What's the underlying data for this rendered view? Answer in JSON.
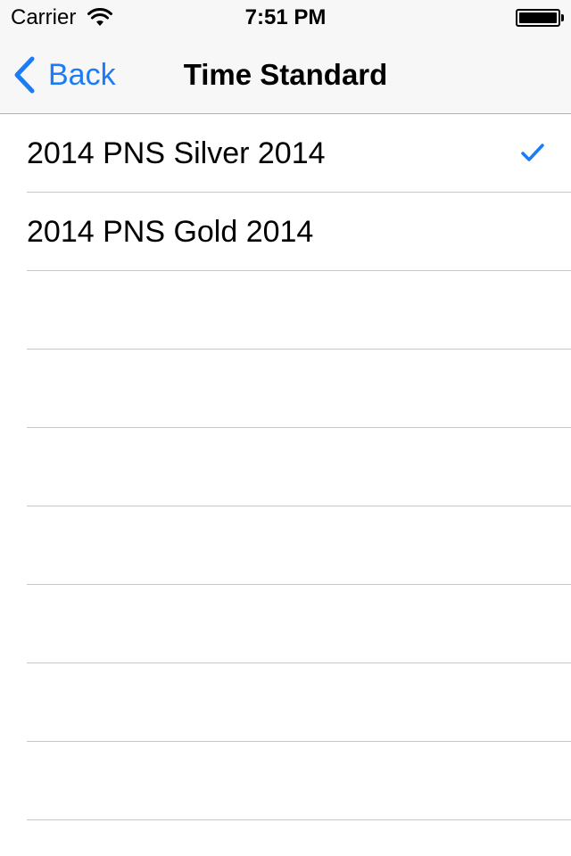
{
  "status_bar": {
    "carrier": "Carrier",
    "time": "7:51 PM",
    "wifi_icon": "wifi-icon",
    "battery_icon": "battery-full-icon"
  },
  "nav_bar": {
    "back_label": "Back",
    "title": "Time Standard",
    "back_icon": "chevron-left-icon"
  },
  "colors": {
    "accent": "#1b7cf5",
    "chrome_bg": "#f7f7f7",
    "separator": "#c8c7cc"
  },
  "list": {
    "items": [
      {
        "label": "2014 PNS Silver 2014",
        "selected": true
      },
      {
        "label": "2014 PNS Gold 2014",
        "selected": false
      }
    ],
    "empty_rows": 7,
    "checkmark_icon": "checkmark-icon"
  }
}
